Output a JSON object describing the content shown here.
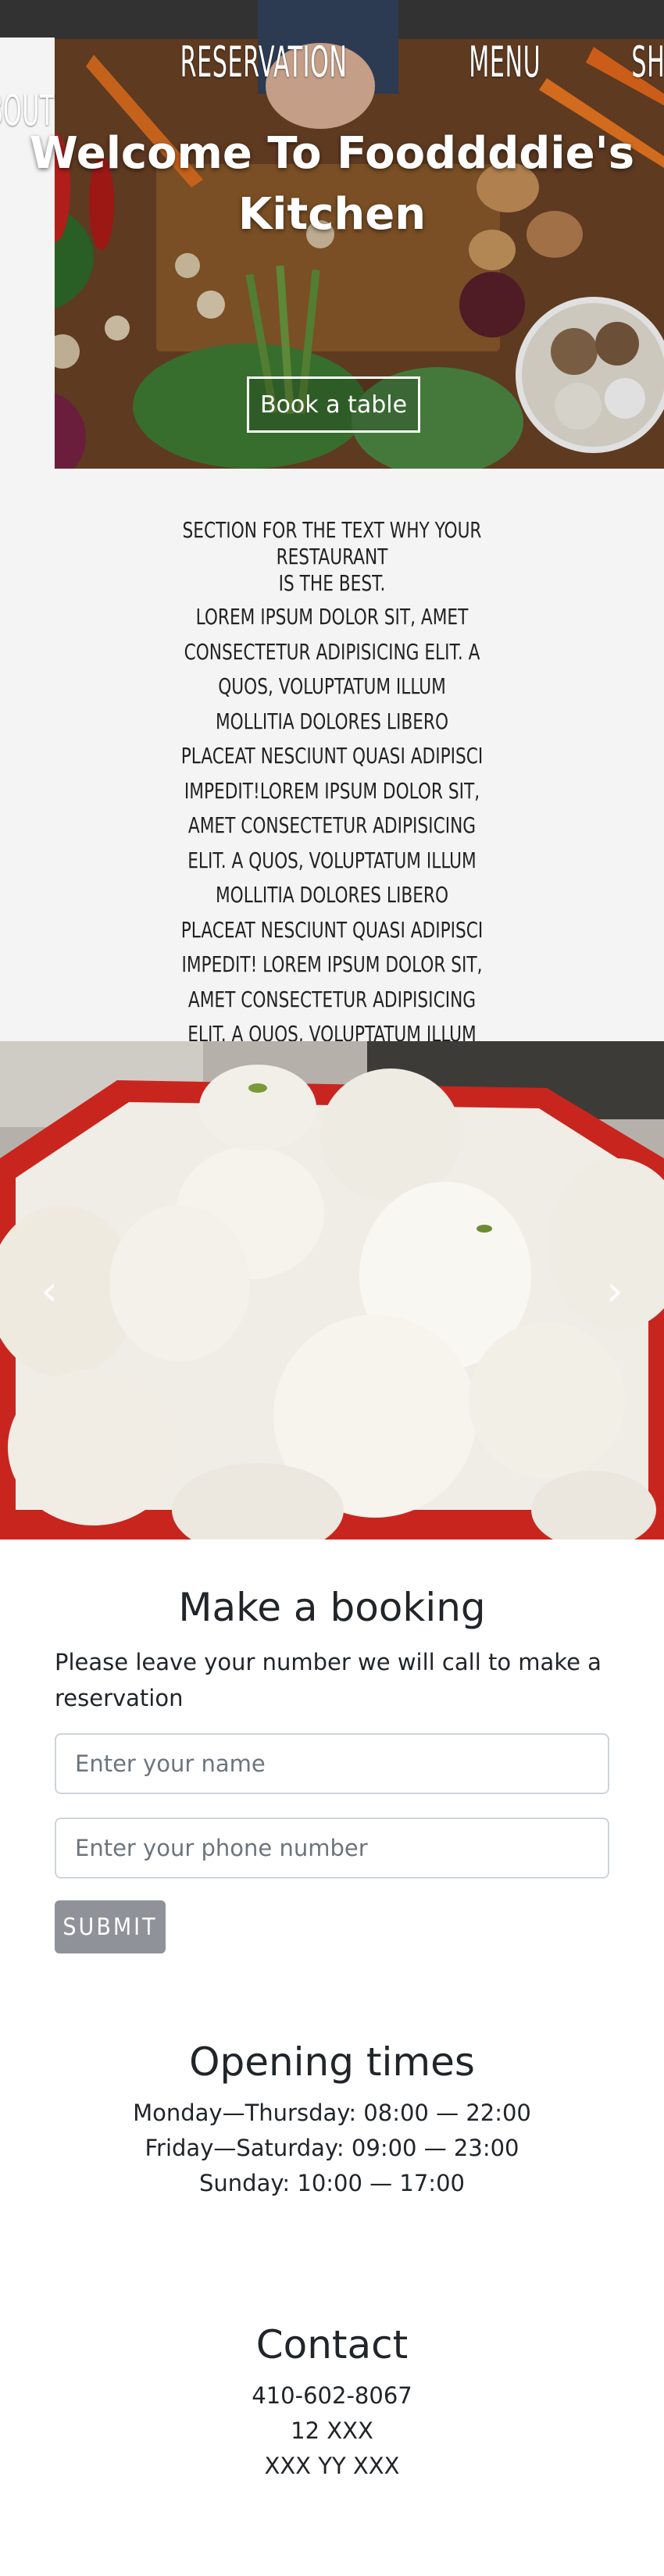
{
  "nav": {
    "items": [
      "ABOUT",
      "RESERVATION",
      "MENU",
      "SHOP"
    ]
  },
  "hero": {
    "title_line1": "Welcome To Fooddddie's",
    "title_line2": "Kitchen",
    "button_label": "Book a table"
  },
  "about": {
    "headline_line1": "SECTION FOR THE TEXT WHY YOUR RESTAURANT",
    "headline_line2": "IS THE BEST.",
    "body": "LOREM IPSUM DOLOR SIT, AMET CONSECTETUR ADIPISICING ELIT. A QUOS, VOLUPTATUM ILLUM MOLLITIA DOLORES LIBERO PLACEAT NESCIUNT QUASI ADIPISCI IMPEDIT!LOREM IPSUM DOLOR SIT, AMET CONSECTETUR ADIPISICING ELIT. A QUOS, VOLUPTATUM ILLUM MOLLITIA DOLORES LIBERO PLACEAT NESCIUNT QUASI ADIPISCI IMPEDIT! LOREM IPSUM DOLOR SIT, AMET CONSECTETUR ADIPISICING ELIT. A QUOS, VOLUPTATUM ILLUM MOLLITIA DOLORES LIBERO PLACEAT NESCIUNT QUASI ADIPISCI IMPEDIT!LOREM IPSUM DOLOR SIT."
  },
  "carousel": {
    "prev_icon": "chevron-left-icon",
    "next_icon": "chevron-right-icon",
    "prev_glyph": "‹",
    "next_glyph": "›"
  },
  "booking": {
    "title": "Make a booking",
    "description": "Please leave your number we will call to make a reservation",
    "name_placeholder": "Enter your name",
    "phone_placeholder": "Enter your phone number",
    "submit_label": "SUBMIT"
  },
  "opening": {
    "title": "Opening times",
    "lines": [
      "Monday—Thursday: 08:00 — 22:00",
      "Friday—Saturday: 09:00 — 23:00",
      "Sunday: 10:00 — 17:00"
    ]
  },
  "contact": {
    "title": "Contact",
    "lines": [
      "410-602-8067",
      "12 XXX",
      "XXX YY XXX"
    ]
  },
  "colors": {
    "about_bg": "#f4f4f4",
    "submit_bg": "#8f9399",
    "bowl_red": "#c9251f"
  }
}
